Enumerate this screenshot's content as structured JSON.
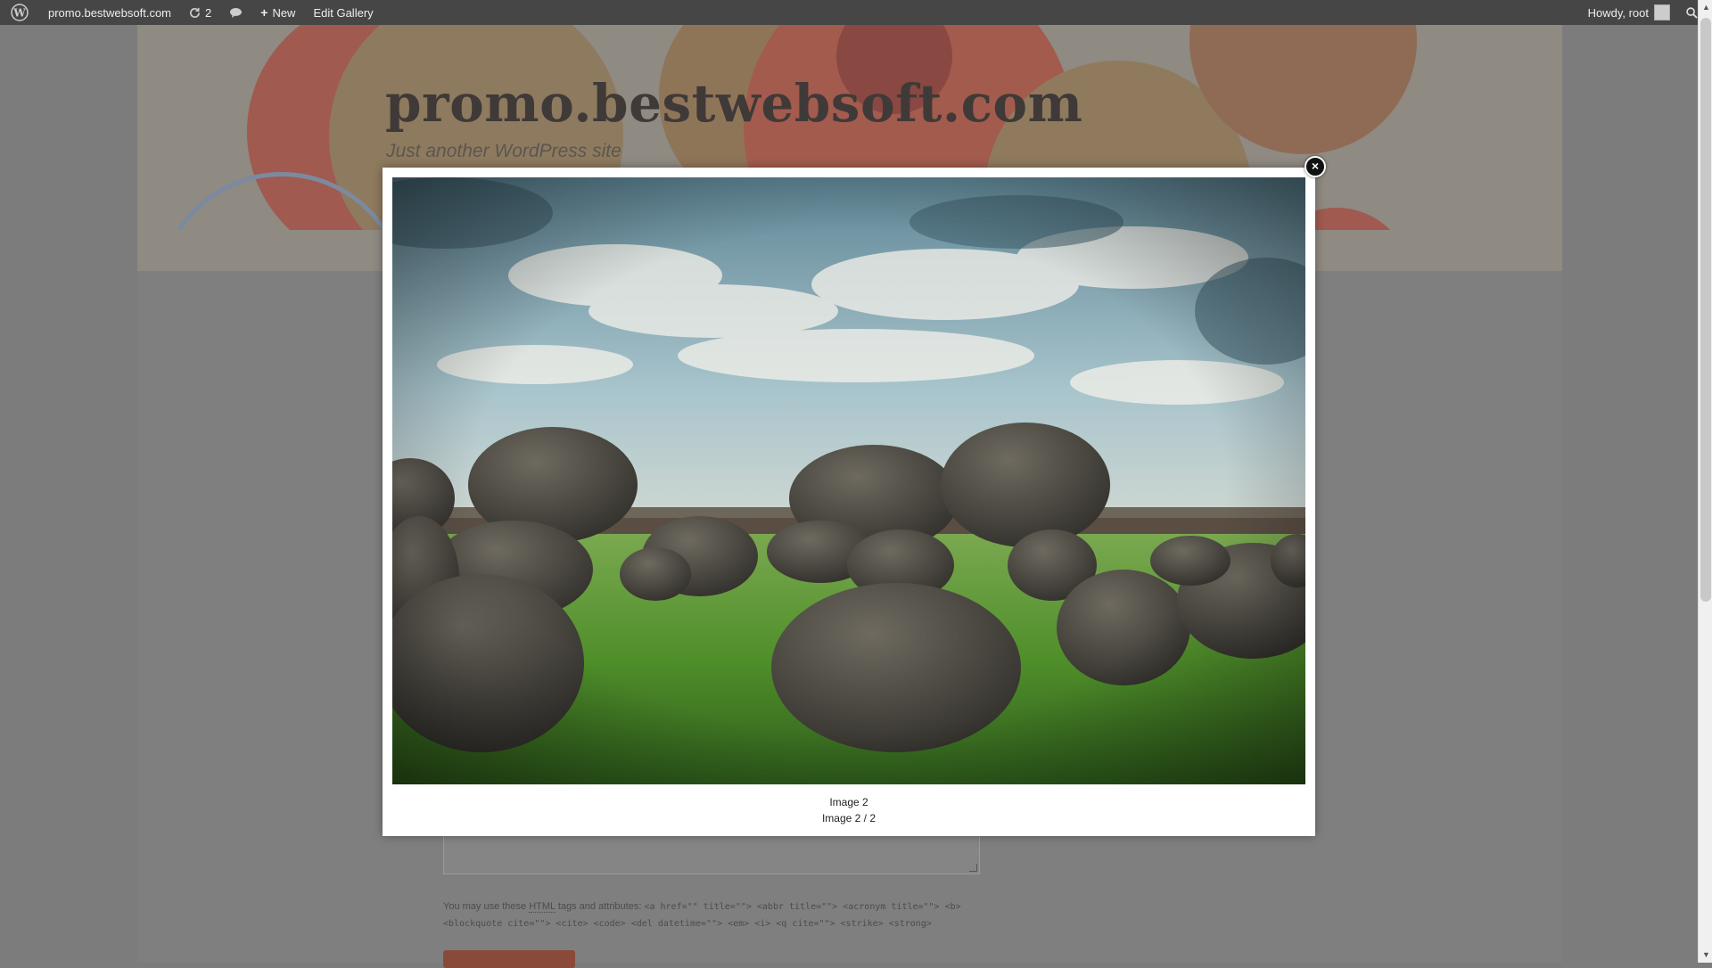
{
  "admin_bar": {
    "site_name": "promo.bestwebsoft.com",
    "updates_count": "2",
    "new_label": "New",
    "edit_label": "Edit Gallery",
    "greeting": "Howdy, root"
  },
  "site": {
    "title": "promo.bestwebsoft.com",
    "tagline": "Just another WordPress site"
  },
  "comment_form": {
    "allowed_tags_intro": "You may use these",
    "allowed_tags_abbr": "HTML",
    "allowed_tags_suffix": "tags and attributes:",
    "allowed_tags_line1": "<a href=\"\" title=\"\"> <abbr title=\"\"> <acronym title=\"\"> <b>",
    "allowed_tags_line2": "<blockquote cite=\"\"> <cite> <code> <del datetime=\"\"> <em> <i> <q cite=\"\"> <strike> <strong>"
  },
  "lightbox": {
    "title": "Image 2",
    "counter": "Image 2 / 2",
    "close_symbol": "×"
  },
  "colors": {
    "admin_bar": "#464646",
    "overlay_page": "#7f7f7f",
    "lightbox_bg": "#ffffff"
  }
}
